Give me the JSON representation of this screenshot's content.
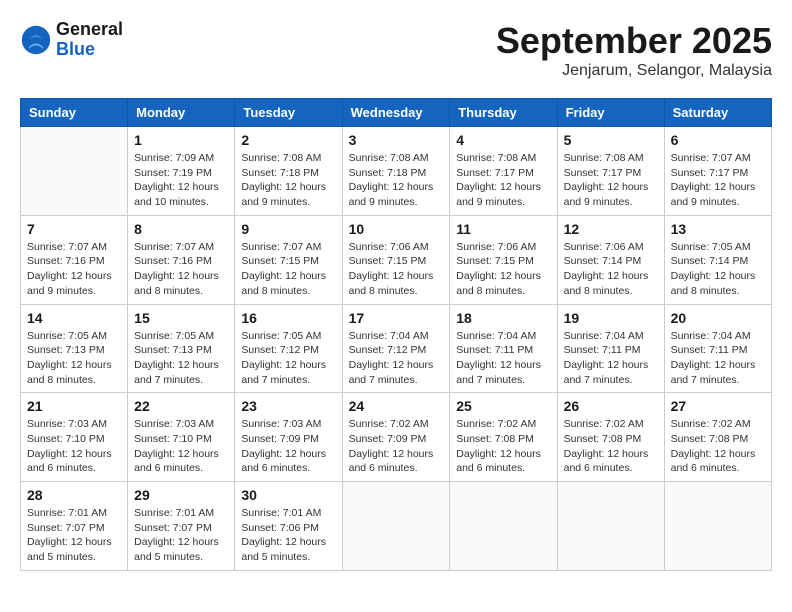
{
  "app": {
    "logo_line1": "General",
    "logo_line2": "Blue"
  },
  "title": "September 2025",
  "subtitle": "Jenjarum, Selangor, Malaysia",
  "days_of_week": [
    "Sunday",
    "Monday",
    "Tuesday",
    "Wednesday",
    "Thursday",
    "Friday",
    "Saturday"
  ],
  "weeks": [
    [
      {
        "day": "",
        "info": ""
      },
      {
        "day": "1",
        "info": "Sunrise: 7:09 AM\nSunset: 7:19 PM\nDaylight: 12 hours\nand 10 minutes."
      },
      {
        "day": "2",
        "info": "Sunrise: 7:08 AM\nSunset: 7:18 PM\nDaylight: 12 hours\nand 9 minutes."
      },
      {
        "day": "3",
        "info": "Sunrise: 7:08 AM\nSunset: 7:18 PM\nDaylight: 12 hours\nand 9 minutes."
      },
      {
        "day": "4",
        "info": "Sunrise: 7:08 AM\nSunset: 7:17 PM\nDaylight: 12 hours\nand 9 minutes."
      },
      {
        "day": "5",
        "info": "Sunrise: 7:08 AM\nSunset: 7:17 PM\nDaylight: 12 hours\nand 9 minutes."
      },
      {
        "day": "6",
        "info": "Sunrise: 7:07 AM\nSunset: 7:17 PM\nDaylight: 12 hours\nand 9 minutes."
      }
    ],
    [
      {
        "day": "7",
        "info": "Sunrise: 7:07 AM\nSunset: 7:16 PM\nDaylight: 12 hours\nand 9 minutes."
      },
      {
        "day": "8",
        "info": "Sunrise: 7:07 AM\nSunset: 7:16 PM\nDaylight: 12 hours\nand 8 minutes."
      },
      {
        "day": "9",
        "info": "Sunrise: 7:07 AM\nSunset: 7:15 PM\nDaylight: 12 hours\nand 8 minutes."
      },
      {
        "day": "10",
        "info": "Sunrise: 7:06 AM\nSunset: 7:15 PM\nDaylight: 12 hours\nand 8 minutes."
      },
      {
        "day": "11",
        "info": "Sunrise: 7:06 AM\nSunset: 7:15 PM\nDaylight: 12 hours\nand 8 minutes."
      },
      {
        "day": "12",
        "info": "Sunrise: 7:06 AM\nSunset: 7:14 PM\nDaylight: 12 hours\nand 8 minutes."
      },
      {
        "day": "13",
        "info": "Sunrise: 7:05 AM\nSunset: 7:14 PM\nDaylight: 12 hours\nand 8 minutes."
      }
    ],
    [
      {
        "day": "14",
        "info": "Sunrise: 7:05 AM\nSunset: 7:13 PM\nDaylight: 12 hours\nand 8 minutes."
      },
      {
        "day": "15",
        "info": "Sunrise: 7:05 AM\nSunset: 7:13 PM\nDaylight: 12 hours\nand 7 minutes."
      },
      {
        "day": "16",
        "info": "Sunrise: 7:05 AM\nSunset: 7:12 PM\nDaylight: 12 hours\nand 7 minutes."
      },
      {
        "day": "17",
        "info": "Sunrise: 7:04 AM\nSunset: 7:12 PM\nDaylight: 12 hours\nand 7 minutes."
      },
      {
        "day": "18",
        "info": "Sunrise: 7:04 AM\nSunset: 7:11 PM\nDaylight: 12 hours\nand 7 minutes."
      },
      {
        "day": "19",
        "info": "Sunrise: 7:04 AM\nSunset: 7:11 PM\nDaylight: 12 hours\nand 7 minutes."
      },
      {
        "day": "20",
        "info": "Sunrise: 7:04 AM\nSunset: 7:11 PM\nDaylight: 12 hours\nand 7 minutes."
      }
    ],
    [
      {
        "day": "21",
        "info": "Sunrise: 7:03 AM\nSunset: 7:10 PM\nDaylight: 12 hours\nand 6 minutes."
      },
      {
        "day": "22",
        "info": "Sunrise: 7:03 AM\nSunset: 7:10 PM\nDaylight: 12 hours\nand 6 minutes."
      },
      {
        "day": "23",
        "info": "Sunrise: 7:03 AM\nSunset: 7:09 PM\nDaylight: 12 hours\nand 6 minutes."
      },
      {
        "day": "24",
        "info": "Sunrise: 7:02 AM\nSunset: 7:09 PM\nDaylight: 12 hours\nand 6 minutes."
      },
      {
        "day": "25",
        "info": "Sunrise: 7:02 AM\nSunset: 7:08 PM\nDaylight: 12 hours\nand 6 minutes."
      },
      {
        "day": "26",
        "info": "Sunrise: 7:02 AM\nSunset: 7:08 PM\nDaylight: 12 hours\nand 6 minutes."
      },
      {
        "day": "27",
        "info": "Sunrise: 7:02 AM\nSunset: 7:08 PM\nDaylight: 12 hours\nand 6 minutes."
      }
    ],
    [
      {
        "day": "28",
        "info": "Sunrise: 7:01 AM\nSunset: 7:07 PM\nDaylight: 12 hours\nand 5 minutes."
      },
      {
        "day": "29",
        "info": "Sunrise: 7:01 AM\nSunset: 7:07 PM\nDaylight: 12 hours\nand 5 minutes."
      },
      {
        "day": "30",
        "info": "Sunrise: 7:01 AM\nSunset: 7:06 PM\nDaylight: 12 hours\nand 5 minutes."
      },
      {
        "day": "",
        "info": ""
      },
      {
        "day": "",
        "info": ""
      },
      {
        "day": "",
        "info": ""
      },
      {
        "day": "",
        "info": ""
      }
    ]
  ]
}
